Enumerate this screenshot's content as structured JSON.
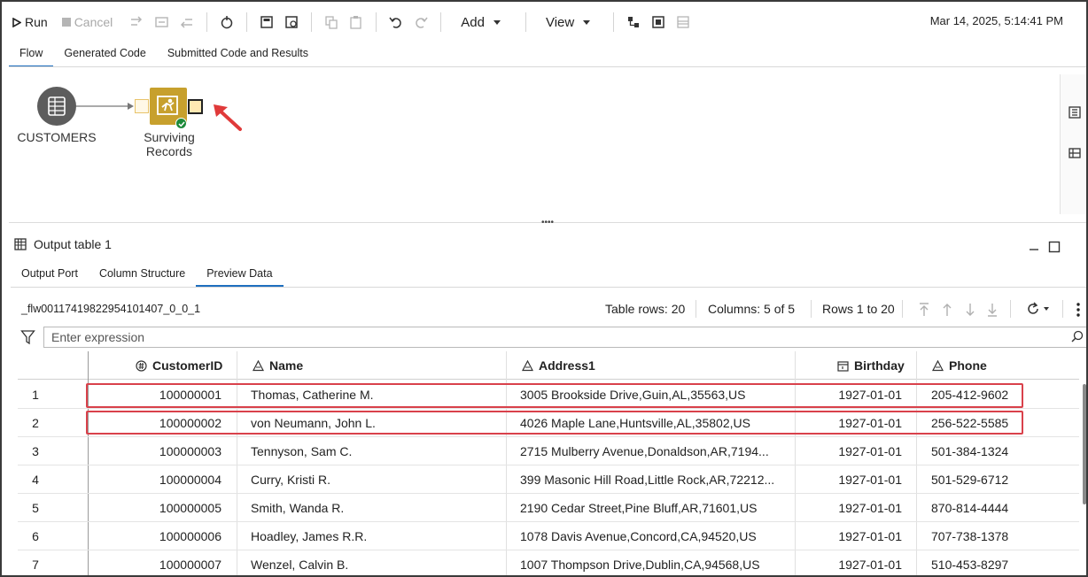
{
  "toolbar": {
    "run_label": "Run",
    "cancel_label": "Cancel",
    "add_label": "Add",
    "view_label": "View",
    "timestamp": "Mar 14, 2025, 5:14:41 PM"
  },
  "tabs": [
    {
      "label": "Flow",
      "active": true
    },
    {
      "label": "Generated Code",
      "active": false
    },
    {
      "label": "Submitted Code and Results",
      "active": false
    }
  ],
  "flow": {
    "source_node_label": "CUSTOMERS",
    "step_node_label_line1": "Surviving",
    "step_node_label_line2": "Records",
    "step_status": "completed"
  },
  "output": {
    "pane_title": "Output table 1",
    "sub_tabs": [
      {
        "label": "Output Port",
        "active": false
      },
      {
        "label": "Column Structure",
        "active": false
      },
      {
        "label": "Preview Data",
        "active": true
      }
    ],
    "table_name": "_flw00117419822954101407_0_0_1",
    "table_rows": "Table rows: 20",
    "columns": "Columns: 5 of 5",
    "rows_range": "Rows 1 to 20",
    "expression_placeholder": "Enter expression"
  },
  "grid": {
    "headers": [
      "CustomerID",
      "Name",
      "Address1",
      "Birthday",
      "Phone"
    ],
    "header_icons": [
      "numeric-column-icon",
      "character-column-icon",
      "character-column-icon",
      "date-column-icon",
      "character-column-icon"
    ],
    "rows": [
      {
        "n": "1",
        "id": "100000001",
        "name": "Thomas, Catherine M.",
        "addr": "3005 Brookside Drive,Guin,AL,35563,US",
        "bday": "1927-01-01",
        "phone": "205-412-9602"
      },
      {
        "n": "2",
        "id": "100000002",
        "name": "von Neumann, John L.",
        "addr": "4026 Maple Lane,Huntsville,AL,35802,US",
        "bday": "1927-01-01",
        "phone": "256-522-5585"
      },
      {
        "n": "3",
        "id": "100000003",
        "name": "Tennyson, Sam C.",
        "addr": "2715 Mulberry Avenue,Donaldson,AR,7194...",
        "bday": "1927-01-01",
        "phone": "501-384-1324"
      },
      {
        "n": "4",
        "id": "100000004",
        "name": "Curry, Kristi R.",
        "addr": "399 Masonic Hill Road,Little Rock,AR,72212...",
        "bday": "1927-01-01",
        "phone": "501-529-6712"
      },
      {
        "n": "5",
        "id": "100000005",
        "name": "Smith, Wanda R.",
        "addr": "2190 Cedar Street,Pine Bluff,AR,71601,US",
        "bday": "1927-01-01",
        "phone": "870-814-4444"
      },
      {
        "n": "6",
        "id": "100000006",
        "name": "Hoadley, James R.R.",
        "addr": "1078 Davis Avenue,Concord,CA,94520,US",
        "bday": "1927-01-01",
        "phone": "707-738-1378"
      },
      {
        "n": "7",
        "id": "100000007",
        "name": "Wenzel, Calvin B.",
        "addr": "1007 Thompson Drive,Dublin,CA,94568,US",
        "bday": "1927-01-01",
        "phone": "510-453-8297"
      }
    ],
    "highlighted_rows": [
      1,
      2
    ]
  },
  "colors": {
    "accent": "#1f6fbf",
    "step_node": "#c7a02d",
    "source_node": "#5d5d5d",
    "highlight": "#d9414b",
    "annotation_arrow": "#e03a3a",
    "status_ok": "#1e8a3a"
  }
}
